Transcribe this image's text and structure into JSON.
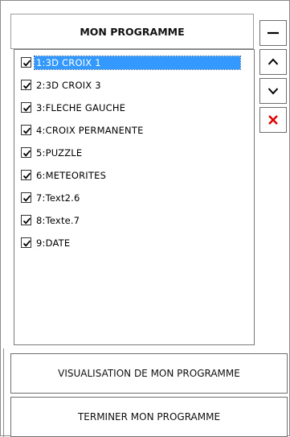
{
  "header": {
    "title": "MON PROGRAMME"
  },
  "list": {
    "items": [
      {
        "label": "1:3D CROIX 1",
        "checked": true,
        "selected": true
      },
      {
        "label": "2:3D CROIX 3",
        "checked": true,
        "selected": false
      },
      {
        "label": "3:FLECHE GAUCHE",
        "checked": true,
        "selected": false
      },
      {
        "label": "4:CROIX PERMANENTE",
        "checked": true,
        "selected": false
      },
      {
        "label": "5:PUZZLE",
        "checked": true,
        "selected": false
      },
      {
        "label": "6:METEORITES",
        "checked": true,
        "selected": false
      },
      {
        "label": "7:Text2.6",
        "checked": true,
        "selected": false
      },
      {
        "label": "8:Texte.7",
        "checked": true,
        "selected": false
      },
      {
        "label": "9:DATE",
        "checked": true,
        "selected": false
      }
    ]
  },
  "side_buttons": [
    {
      "icon": "minus-icon"
    },
    {
      "icon": "chevron-up-icon"
    },
    {
      "icon": "chevron-down-icon"
    },
    {
      "icon": "close-icon",
      "color": "#e00000"
    }
  ],
  "footer": {
    "preview_label": "VISUALISATION DE MON PROGRAMME",
    "finish_label": "TERMINER MON PROGRAMME"
  },
  "colors": {
    "selection": "#3399ff",
    "delete": "#e00000"
  }
}
